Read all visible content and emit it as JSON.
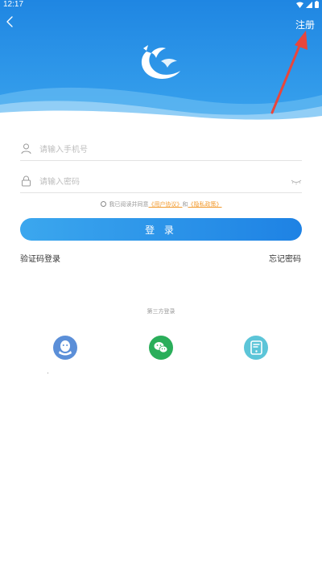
{
  "status_bar": {
    "time": "12:17"
  },
  "header": {
    "register_label": "注册"
  },
  "form": {
    "phone_placeholder": "请输入手机号",
    "password_placeholder": "请输入密码",
    "agreement_prefix": "我已阅读并同意",
    "user_agreement": "《用户协议》",
    "agreement_and": "和",
    "privacy_policy": "《隐私政策》",
    "login_label": "登 录",
    "sms_login": "验证码登录",
    "forgot_password": "忘记密码"
  },
  "third_party": {
    "label": "第三方登录",
    "providers": [
      "qq",
      "wechat",
      "other"
    ]
  },
  "colors": {
    "header_blue": "#2389e3",
    "button_gradient_start": "#3ba7ee",
    "button_gradient_end": "#1e82e4",
    "link_orange": "#f29a2e",
    "annotation_red": "#e8463c",
    "qq_blue": "#5b8fd8",
    "wechat_green": "#2aae5a",
    "other_teal": "#5cc5d8"
  },
  "icons": [
    "back-arrow-icon",
    "wifi-icon",
    "signal-icon",
    "battery-icon",
    "user-icon",
    "lock-icon",
    "eye-closed-icon",
    "qq-icon",
    "wechat-icon",
    "phone-icon"
  ]
}
